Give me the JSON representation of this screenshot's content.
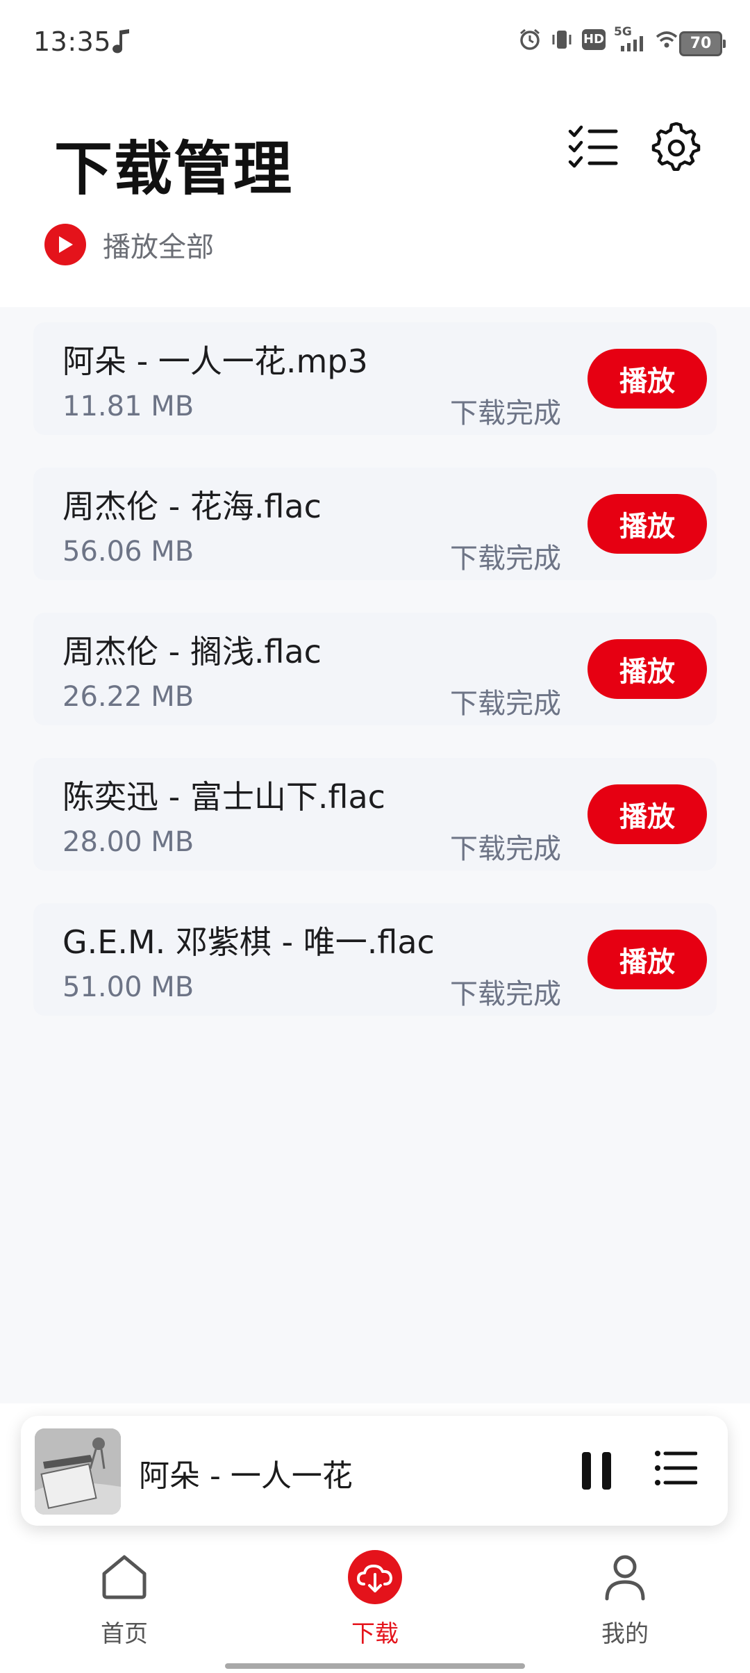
{
  "status_bar": {
    "time": "13:35",
    "network": "5G",
    "hd": "HD",
    "battery": "70"
  },
  "header": {
    "title": "下载管理",
    "play_all_label": "播放全部"
  },
  "downloads": [
    {
      "name": "阿朵 - 一人一花.mp3",
      "size": "11.81 MB",
      "status": "下载完成",
      "play_label": "播放"
    },
    {
      "name": "周杰伦 - 花海.flac",
      "size": "56.06 MB",
      "status": "下载完成",
      "play_label": "播放"
    },
    {
      "name": "周杰伦 - 搁浅.flac",
      "size": "26.22 MB",
      "status": "下载完成",
      "play_label": "播放"
    },
    {
      "name": "陈奕迅 - 富士山下.flac",
      "size": "28.00 MB",
      "status": "下载完成",
      "play_label": "播放"
    },
    {
      "name": "G.E.M. 邓紫棋 - 唯一.flac",
      "size": "51.00 MB",
      "status": "下载完成",
      "play_label": "播放"
    }
  ],
  "mini_player": {
    "title": "阿朵 - 一人一花"
  },
  "tabs": [
    {
      "label": "首页",
      "icon": "home-icon"
    },
    {
      "label": "下载",
      "icon": "cloud-download-icon"
    },
    {
      "label": "我的",
      "icon": "user-icon"
    }
  ],
  "colors": {
    "accent": "#e60012",
    "background": "#f7f8fa",
    "card": "#f3f5f9",
    "secondary_text": "#6d7486"
  }
}
